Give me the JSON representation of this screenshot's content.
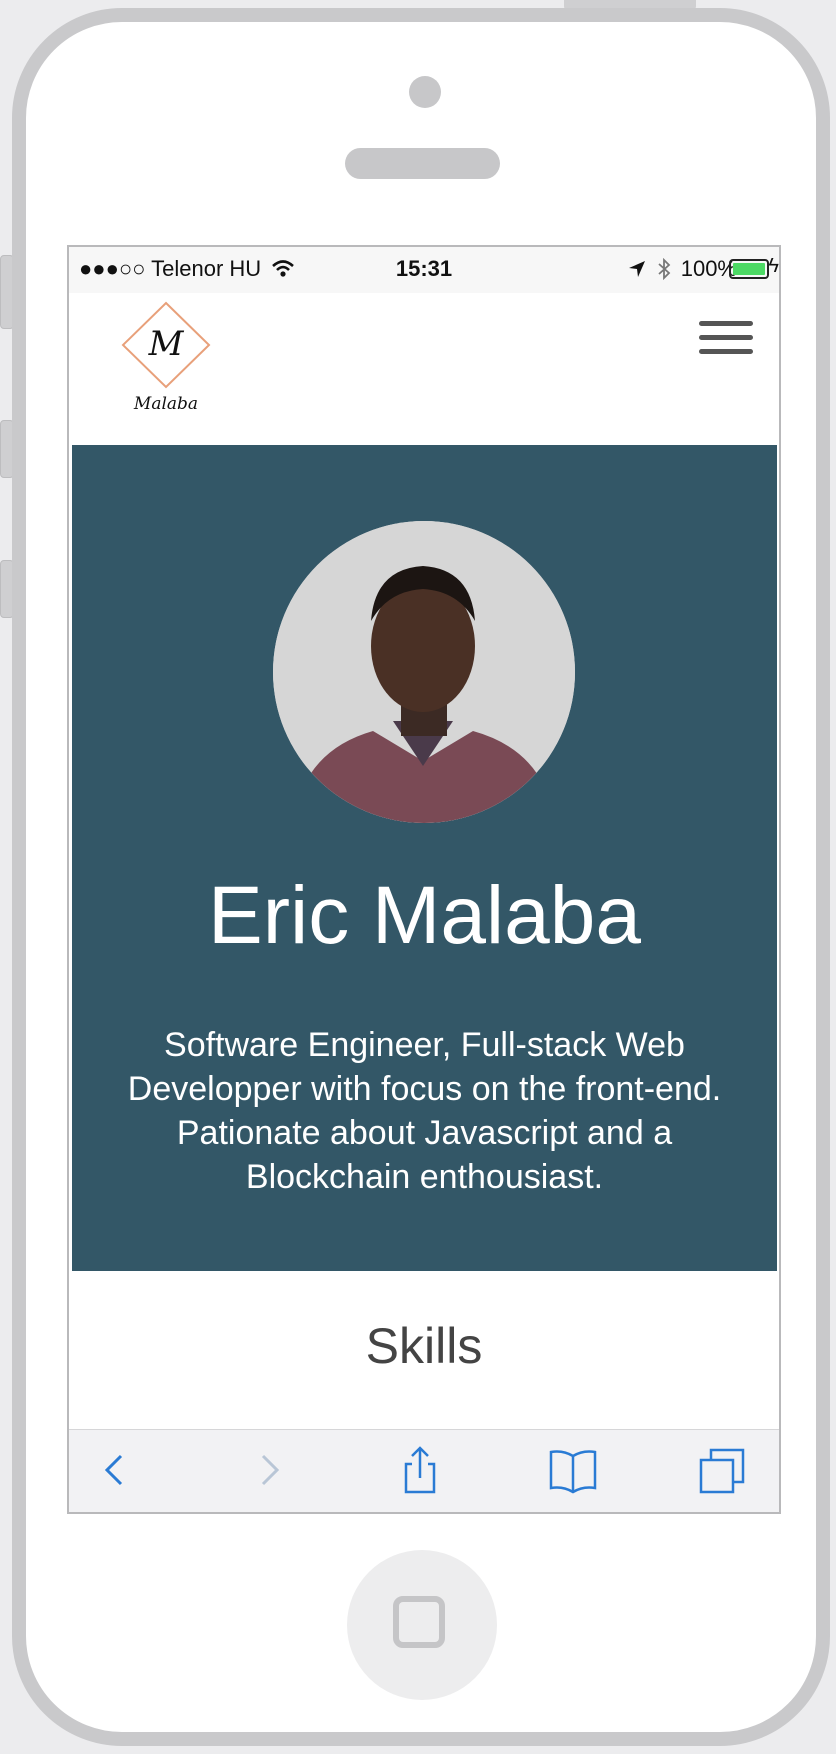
{
  "status_bar": {
    "carrier": "●●●○○ Telenor HU",
    "time": "15:31",
    "battery": "100%"
  },
  "header": {
    "logo_text": "Malaba",
    "logo_letter": "M"
  },
  "hero": {
    "name": "Eric Malaba",
    "bio": "Software Engineer, Full-stack Web Developper with focus on the front-end. Pationate about Javascript and a Blockchain enthousiast."
  },
  "sections": {
    "skills_title": "Skills"
  },
  "colors": {
    "hero_bg": "#335767",
    "accent_link": "#2a7bd4",
    "battery": "#4cd964"
  },
  "icons": [
    "wifi-icon",
    "location-arrow-icon",
    "bluetooth-icon",
    "battery-icon",
    "hamburger-menu-icon",
    "back-icon",
    "forward-icon",
    "share-icon",
    "bookmarks-icon",
    "tabs-icon"
  ]
}
